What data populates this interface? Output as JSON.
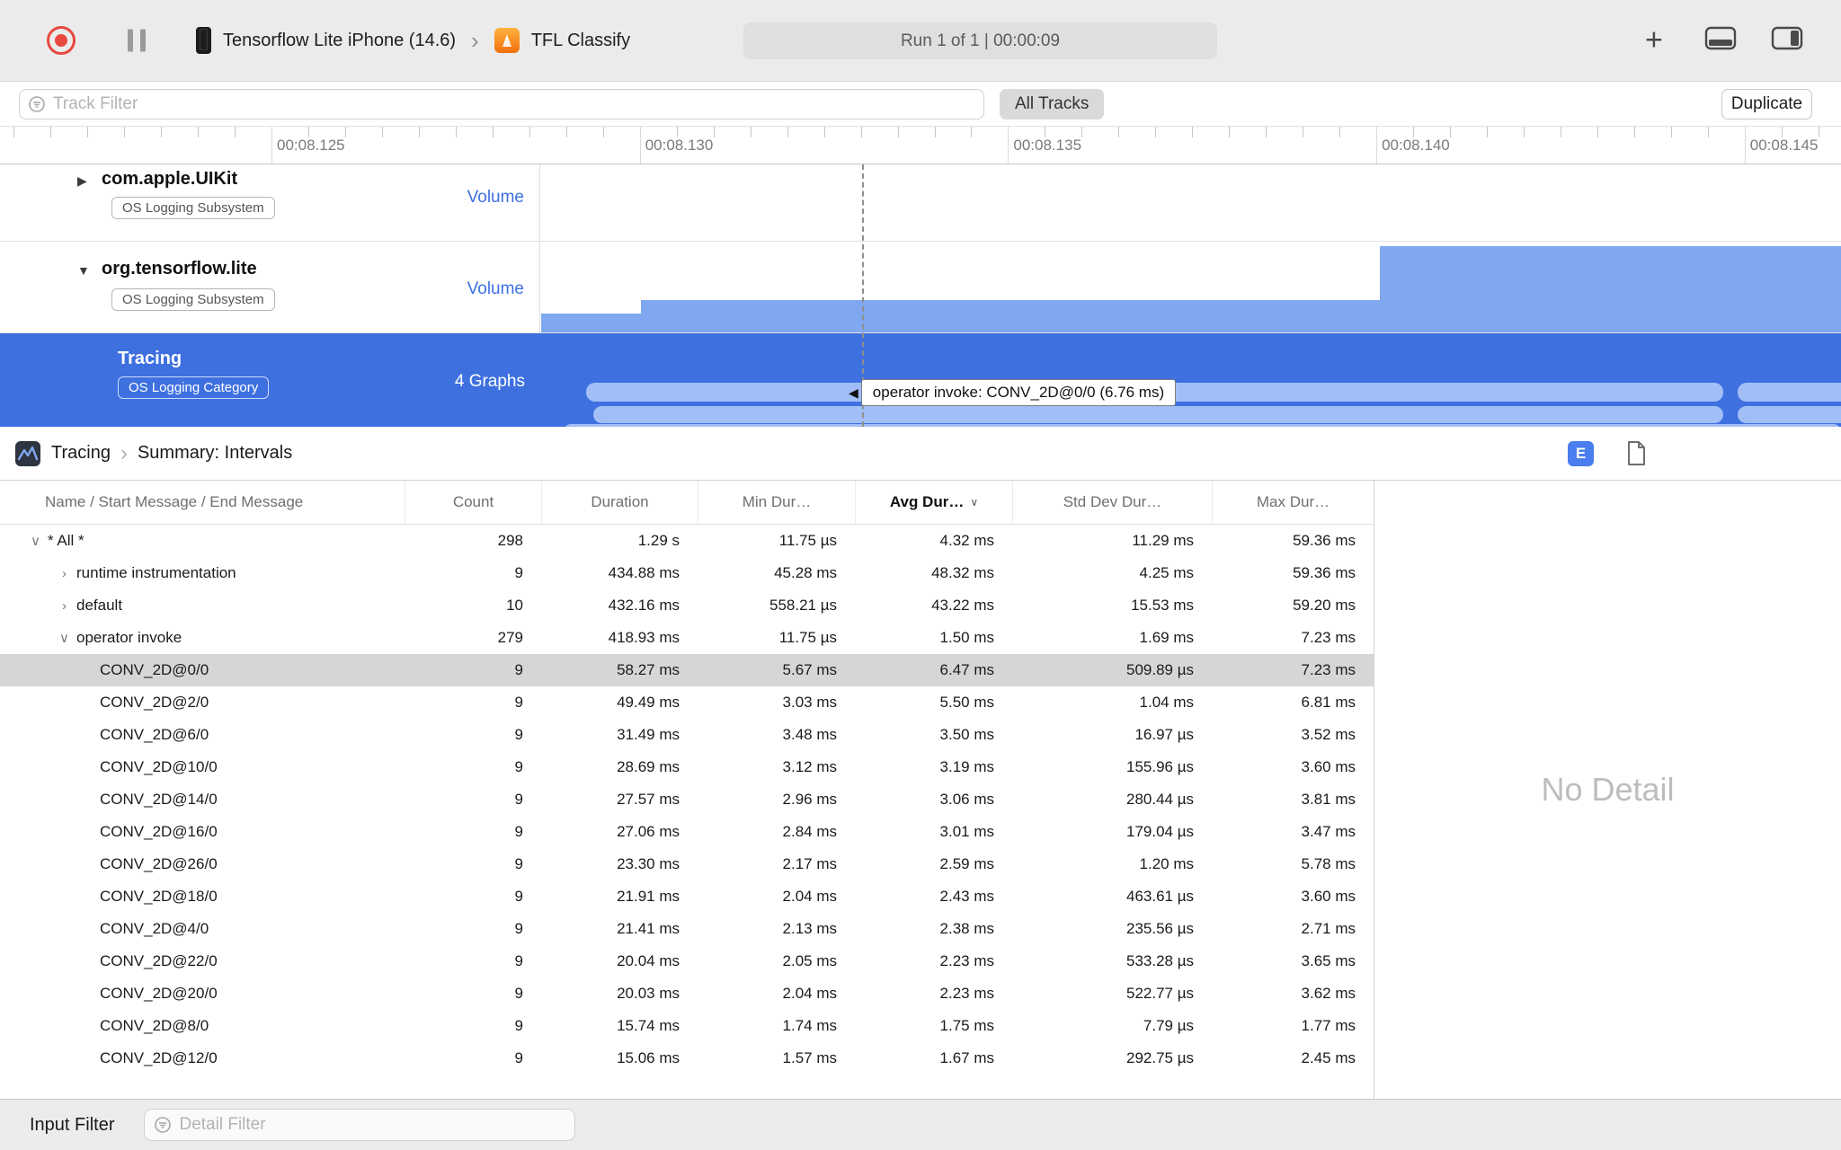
{
  "toolbar": {
    "device_name": "Tensorflow Lite iPhone (14.6)",
    "target_name": "TFL Classify",
    "run_status": "Run 1 of 1  |  00:00:09"
  },
  "filter_bar": {
    "track_filter_placeholder": "Track Filter",
    "all_tracks_label": "All Tracks",
    "duplicate_label": "Duplicate"
  },
  "ruler": {
    "ticks": [
      "00:08.125",
      "00:08.130",
      "00:08.135",
      "00:08.140",
      "00:08.145"
    ]
  },
  "tracks": [
    {
      "name": "com.apple.UIKit",
      "badge": "OS Logging Subsystem",
      "lane_label": "Volume",
      "disclosure": "collapsed"
    },
    {
      "name": "org.tensorflow.lite",
      "badge": "OS Logging Subsystem",
      "lane_label": "Volume",
      "disclosure": "expanded"
    },
    {
      "name": "Tracing",
      "badge": "OS Logging Category",
      "lane_label": "4 Graphs",
      "selected": true
    }
  ],
  "tooltip": {
    "text": "operator invoke: CONV_2D@0/0 (6.76 ms)"
  },
  "detail": {
    "breadcrumb": {
      "section": "Tracing",
      "page": "Summary: Intervals"
    },
    "extended_detail_button": "E",
    "no_detail": "No Detail",
    "columns": {
      "name": "Name / Start Message / End Message",
      "count": "Count",
      "duration": "Duration",
      "min": "Min Dur…",
      "avg": "Avg Dur…",
      "std": "Std Dev Dur…",
      "max": "Max Dur…"
    },
    "sorted_column": "avg",
    "rows": [
      {
        "name": "* All *",
        "level": 0,
        "disclosure": "expanded",
        "count": "298",
        "duration": "1.29 s",
        "min": "11.75 µs",
        "avg": "4.32 ms",
        "std": "11.29 ms",
        "max": "59.36 ms"
      },
      {
        "name": "runtime instrumentation",
        "level": 1,
        "disclosure": "collapsed",
        "count": "9",
        "duration": "434.88 ms",
        "min": "45.28 ms",
        "avg": "48.32 ms",
        "std": "4.25 ms",
        "max": "59.36 ms"
      },
      {
        "name": "default",
        "level": 1,
        "disclosure": "collapsed",
        "count": "10",
        "duration": "432.16 ms",
        "min": "558.21 µs",
        "avg": "43.22 ms",
        "std": "15.53 ms",
        "max": "59.20 ms"
      },
      {
        "name": "operator invoke",
        "level": 1,
        "disclosure": "expanded",
        "count": "279",
        "duration": "418.93 ms",
        "min": "11.75 µs",
        "avg": "1.50 ms",
        "std": "1.69 ms",
        "max": "7.23 ms"
      },
      {
        "name": "CONV_2D@0/0",
        "level": 2,
        "selected": true,
        "count": "9",
        "duration": "58.27 ms",
        "min": "5.67 ms",
        "avg": "6.47 ms",
        "std": "509.89 µs",
        "max": "7.23 ms"
      },
      {
        "name": "CONV_2D@2/0",
        "level": 2,
        "count": "9",
        "duration": "49.49 ms",
        "min": "3.03 ms",
        "avg": "5.50 ms",
        "std": "1.04 ms",
        "max": "6.81 ms"
      },
      {
        "name": "CONV_2D@6/0",
        "level": 2,
        "count": "9",
        "duration": "31.49 ms",
        "min": "3.48 ms",
        "avg": "3.50 ms",
        "std": "16.97 µs",
        "max": "3.52 ms"
      },
      {
        "name": "CONV_2D@10/0",
        "level": 2,
        "count": "9",
        "duration": "28.69 ms",
        "min": "3.12 ms",
        "avg": "3.19 ms",
        "std": "155.96 µs",
        "max": "3.60 ms"
      },
      {
        "name": "CONV_2D@14/0",
        "level": 2,
        "count": "9",
        "duration": "27.57 ms",
        "min": "2.96 ms",
        "avg": "3.06 ms",
        "std": "280.44 µs",
        "max": "3.81 ms"
      },
      {
        "name": "CONV_2D@16/0",
        "level": 2,
        "count": "9",
        "duration": "27.06 ms",
        "min": "2.84 ms",
        "avg": "3.01 ms",
        "std": "179.04 µs",
        "max": "3.47 ms"
      },
      {
        "name": "CONV_2D@26/0",
        "level": 2,
        "count": "9",
        "duration": "23.30 ms",
        "min": "2.17 ms",
        "avg": "2.59 ms",
        "std": "1.20 ms",
        "max": "5.78 ms"
      },
      {
        "name": "CONV_2D@18/0",
        "level": 2,
        "count": "9",
        "duration": "21.91 ms",
        "min": "2.04 ms",
        "avg": "2.43 ms",
        "std": "463.61 µs",
        "max": "3.60 ms"
      },
      {
        "name": "CONV_2D@4/0",
        "level": 2,
        "count": "9",
        "duration": "21.41 ms",
        "min": "2.13 ms",
        "avg": "2.38 ms",
        "std": "235.56 µs",
        "max": "2.71 ms"
      },
      {
        "name": "CONV_2D@22/0",
        "level": 2,
        "count": "9",
        "duration": "20.04 ms",
        "min": "2.05 ms",
        "avg": "2.23 ms",
        "std": "533.28 µs",
        "max": "3.65 ms"
      },
      {
        "name": "CONV_2D@20/0",
        "level": 2,
        "count": "9",
        "duration": "20.03 ms",
        "min": "2.04 ms",
        "avg": "2.23 ms",
        "std": "522.77 µs",
        "max": "3.62 ms"
      },
      {
        "name": "CONV_2D@8/0",
        "level": 2,
        "count": "9",
        "duration": "15.74 ms",
        "min": "1.74 ms",
        "avg": "1.75 ms",
        "std": "7.79 µs",
        "max": "1.77 ms"
      },
      {
        "name": "CONV_2D@12/0",
        "level": 2,
        "count": "9",
        "duration": "15.06 ms",
        "min": "1.57 ms",
        "avg": "1.67 ms",
        "std": "292.75 µs",
        "max": "2.45 ms"
      }
    ]
  },
  "bottom_bar": {
    "input_filter_label": "Input Filter",
    "detail_filter_placeholder": "Detail Filter"
  },
  "colors": {
    "accent_blue": "#3e70e0",
    "volume_fill": "#7fa8f1",
    "interval_fill": "#a2bef6",
    "record_red": "#e8483f",
    "selected_row": "#d6d6d6"
  }
}
